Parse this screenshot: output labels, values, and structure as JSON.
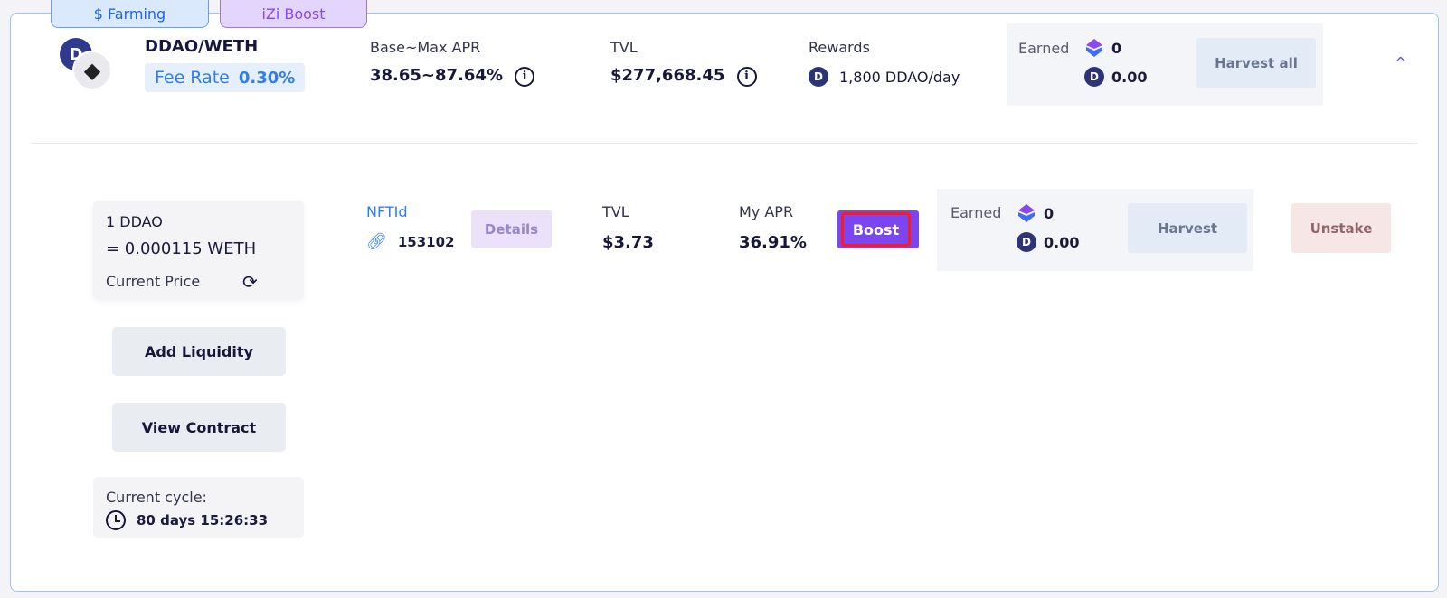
{
  "tags": {
    "farming": "$ Farming",
    "boost": "iZi Boost"
  },
  "pool": {
    "pair": "DDAO/WETH",
    "fee_label": "Fee Rate",
    "fee_value": "0.30%",
    "apr_label": "Base~Max APR",
    "apr_value": "38.65~87.64%",
    "tvl_label": "TVL",
    "tvl_value": "$277,668.45",
    "rewards_label": "Rewards",
    "rewards_value": "1,800 DDAO/day",
    "earned_label": "Earned",
    "earned_izi": "0",
    "earned_ddao": "0.00",
    "harvest_all": "Harvest all",
    "collapse_icon": "^"
  },
  "price_box": {
    "line1": "1 DDAO",
    "line2": "= 0.000115 WETH",
    "label": "Current Price"
  },
  "buttons": {
    "add_liquidity": "Add Liquidity",
    "view_contract": "View Contract"
  },
  "cycle": {
    "label": "Current cycle:",
    "value": "80 days 15:26:33"
  },
  "position": {
    "nft_label": "NFTId",
    "nft_value": "153102",
    "details": "Details",
    "tvl_label": "TVL",
    "tvl_value": "$3.73",
    "apr_label": "My APR",
    "apr_value": "36.91%",
    "boost": "Boost",
    "earned_label": "Earned",
    "earned_izi": "0",
    "earned_ddao": "0.00",
    "harvest": "Harvest",
    "unstake": "Unstake"
  },
  "colors": {
    "accent_purple": "#7b45f0",
    "accent_blue": "#2f7ef0",
    "highlight_red": "#ff1a1a"
  }
}
